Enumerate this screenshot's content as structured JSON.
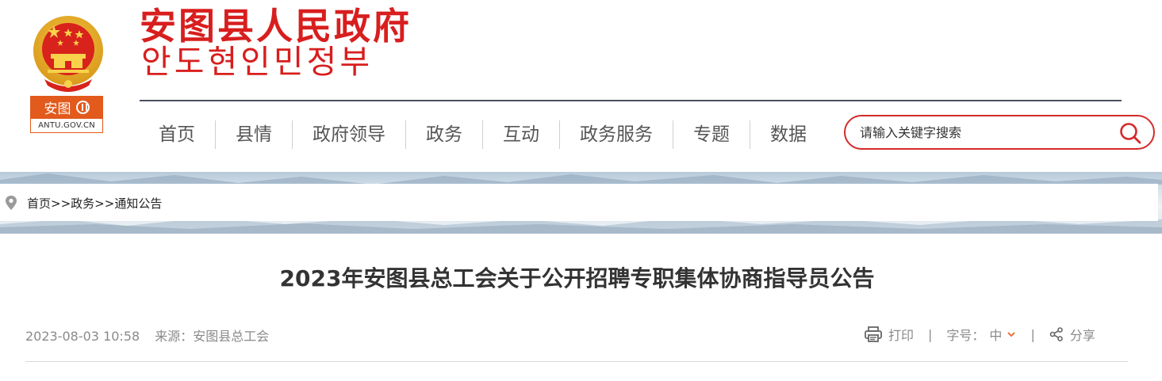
{
  "site": {
    "title_cn": "安图县人民政府",
    "title_kr": "안도현인민정부",
    "badge_name": "安图",
    "badge_domain": "ANTU.GOV.CN"
  },
  "nav": {
    "items": [
      "首页",
      "县情",
      "政府领导",
      "政务",
      "互动",
      "政务服务",
      "专题",
      "数据"
    ]
  },
  "search": {
    "placeholder": "请输入关键字搜索",
    "icon": "search-icon"
  },
  "breadcrumb": {
    "home": "首页",
    "sep1": ">>",
    "section": "政务",
    "sep2": ">>",
    "current": "通知公告",
    "icon": "location-pin-icon"
  },
  "article": {
    "title": "2023年安图县总工会关于公开招聘专职集体协商指导员公告",
    "date": "2023-08-03 10:58",
    "source": "来源：安图县总工会"
  },
  "tools": {
    "print": "打印",
    "sep": "|",
    "font_size_label": "字号：",
    "font_size_value": "中",
    "share": "分享"
  },
  "colors": {
    "brand_red": "#d81e1e",
    "badge_orange": "#e25a1c",
    "accent_chevron": "#e8743b"
  }
}
